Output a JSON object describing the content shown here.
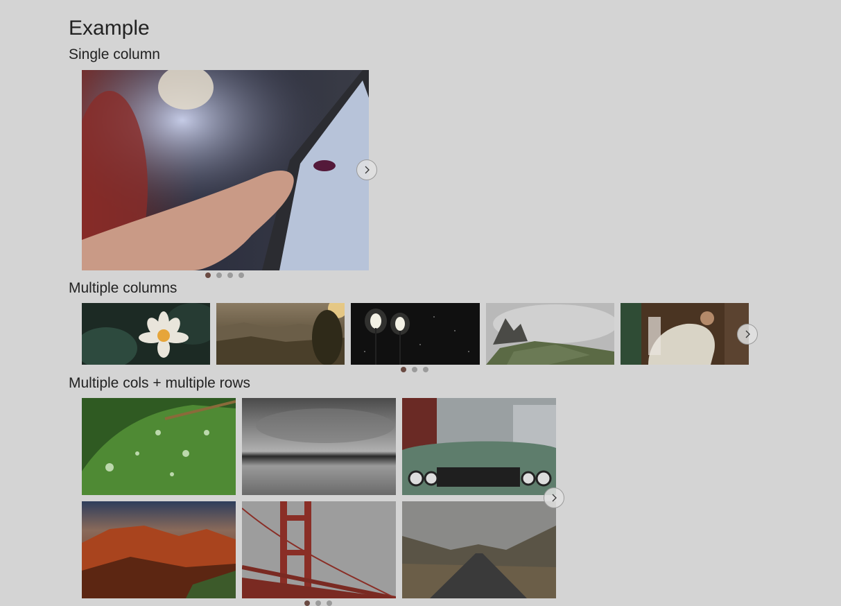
{
  "page": {
    "title": "Example"
  },
  "sections": [
    {
      "title": "Single column",
      "slide_count": 4,
      "active_slide": 1
    },
    {
      "title": "Multiple columns",
      "slide_count": 3,
      "active_slide": 1
    },
    {
      "title": "Multiple cols + multiple rows",
      "slide_count": 3,
      "active_slide": 1
    }
  ],
  "images": {
    "single": [
      "hand-touching-tablet"
    ],
    "multi_columns": [
      "water-lily",
      "misty-valley-sunset",
      "night-street-lamps",
      "cloudy-mountain-ruins",
      "person-in-car"
    ],
    "multi_rows": [
      "leaf-water-drops",
      "monochrome-beach",
      "vintage-green-car",
      "red-rock-canyon",
      "golden-gate-bridge",
      "mountain-road"
    ]
  },
  "icons": {
    "next": "chevron-right-icon"
  },
  "colors": {
    "background": "#d4d4d4",
    "dot": "#9b9b9b",
    "dot_active": "#6a4a42"
  }
}
